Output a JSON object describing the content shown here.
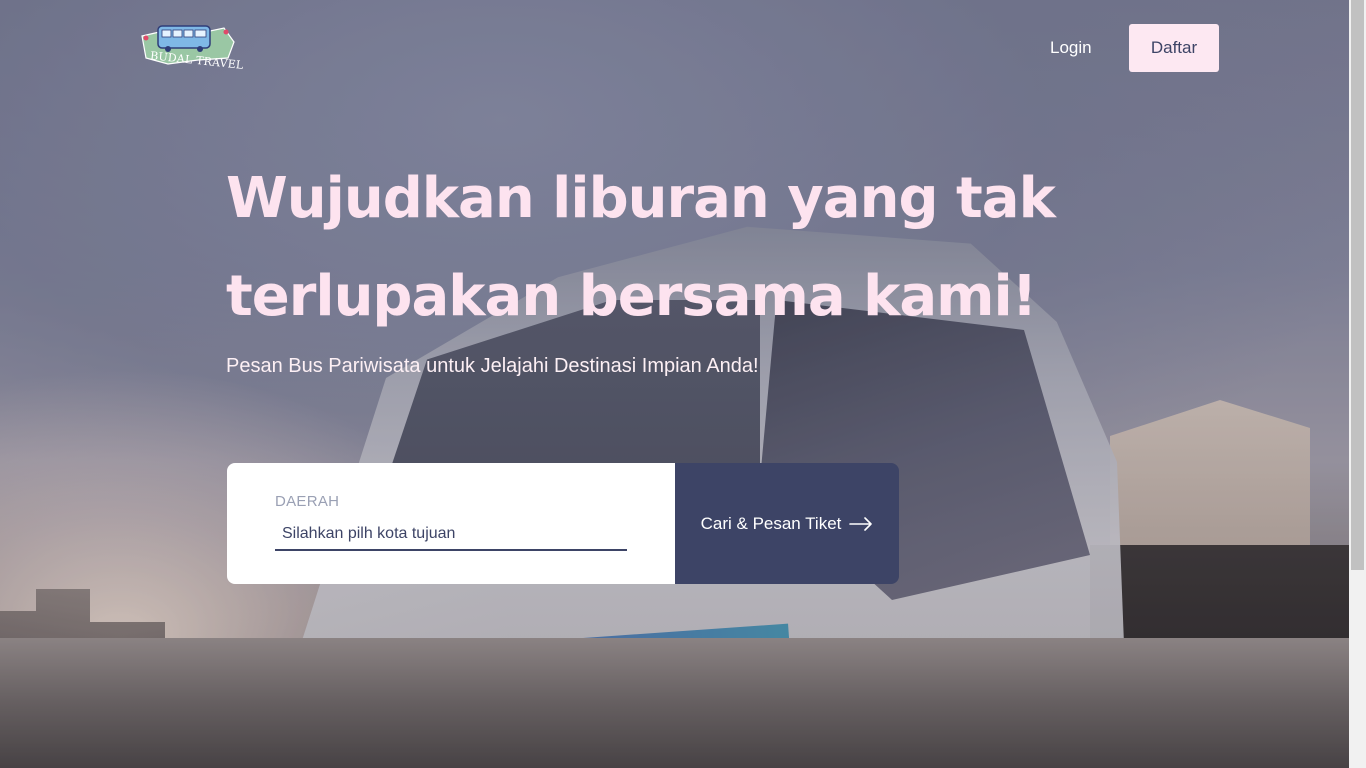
{
  "brand": {
    "logo_text": "BUDAL TRAVEL",
    "logo_icon": "bus-map-logo"
  },
  "nav": {
    "login_label": "Login",
    "register_label": "Daftar"
  },
  "hero": {
    "title": "Wujudkan liburan yang tak terlupakan bersama kami!",
    "subtitle": "Pesan Bus Pariwisata untuk Jelajahi Destinasi Impian Anda!"
  },
  "search": {
    "field_label": "DAERAH",
    "input_placeholder": "Silahkan pilh kota tujuan",
    "input_value": "",
    "button_label": "Cari & Pesan Tiket",
    "button_icon": "arrow-right-icon"
  },
  "colors": {
    "primary": "#3d4466",
    "accent_pink": "#fde8f2",
    "title_pink": "#fde3ef",
    "label_gray": "#9aa0b4"
  }
}
